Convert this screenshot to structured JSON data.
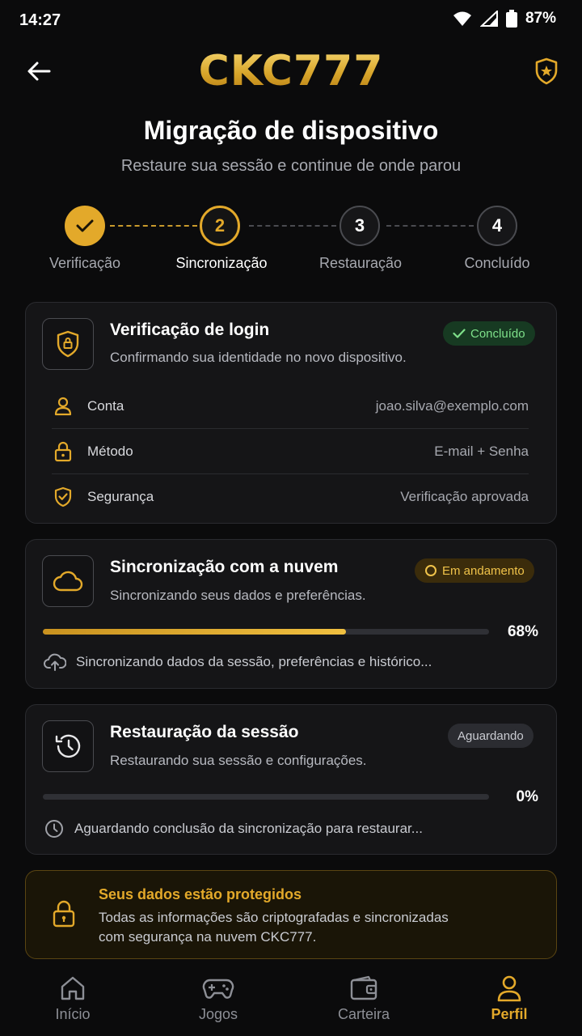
{
  "status_bar": {
    "time": "14:27",
    "battery": "87%"
  },
  "header": {
    "logo": "CKC777"
  },
  "page": {
    "title": "Migração de dispositivo",
    "subtitle": "Restaure sua sessão e continue de onde parou"
  },
  "steps": [
    {
      "number": "1",
      "label": "Verificação",
      "state": "done"
    },
    {
      "number": "2",
      "label": "Sincronização",
      "state": "active"
    },
    {
      "number": "3",
      "label": "Restauração",
      "state": "pending"
    },
    {
      "number": "4",
      "label": "Concluído",
      "state": "pending"
    }
  ],
  "login_card": {
    "title": "Verificação de login",
    "subtitle": "Confirmando sua identidade no novo dispositivo.",
    "badge": "Concluído",
    "rows": [
      {
        "label": "Conta",
        "value": "joao.silva@exemplo.com",
        "icon": "user-icon"
      },
      {
        "label": "Método",
        "value": "E-mail + Senha",
        "icon": "lock-icon"
      },
      {
        "label": "Segurança",
        "value": "Verificação aprovada",
        "icon": "shield-check-icon"
      }
    ]
  },
  "sync_card": {
    "title": "Sincronização com a nuvem",
    "subtitle": "Sincronizando seus dados e preferências.",
    "badge": "Em andamento",
    "progress": 68,
    "progress_label": "68%",
    "note": "Sincronizando dados da sessão, preferências e histórico..."
  },
  "restore_card": {
    "title": "Restauração da sessão",
    "subtitle": "Restaurando sua sessão e configurações.",
    "badge": "Aguardando",
    "progress": 0,
    "progress_label": "0%",
    "note": "Aguardando conclusão da sincronização para restaurar..."
  },
  "protect_card": {
    "title": "Seus dados estão protegidos",
    "line1": "Todas as informações são criptografadas e sincronizadas",
    "line2": "com segurança na nuvem CKC777."
  },
  "bottom_nav": [
    {
      "label": "Início",
      "icon": "home-icon"
    },
    {
      "label": "Jogos",
      "icon": "gamepad-icon"
    },
    {
      "label": "Carteira",
      "icon": "wallet-icon"
    },
    {
      "label": "Perfil",
      "icon": "profile-icon",
      "active": true
    }
  ],
  "colors": {
    "accent": "#e3a92a",
    "success": "#7ee08a",
    "background": "#0b0b0c",
    "card": "#151517"
  }
}
